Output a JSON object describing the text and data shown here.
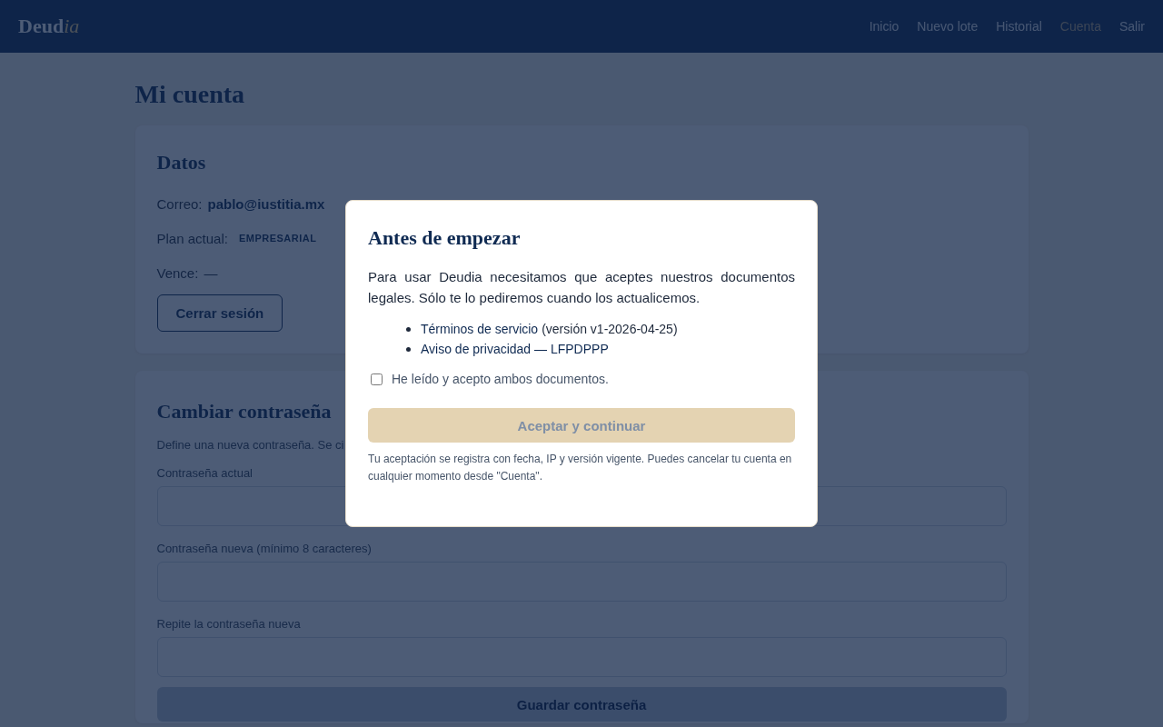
{
  "header": {
    "logo": {
      "main": "Deud",
      "accent": "ia"
    },
    "nav": [
      {
        "label": "Inicio",
        "selected": false
      },
      {
        "label": "Nuevo lote",
        "selected": false
      },
      {
        "label": "Historial",
        "selected": false
      },
      {
        "label": "Cuenta",
        "selected": true
      },
      {
        "label": "Salir",
        "selected": false
      }
    ]
  },
  "page_title": "Mi cuenta",
  "account_card": {
    "title": "Datos",
    "email_label": "Correo:",
    "email": "pablo@iustitia.mx",
    "plan_label": "Plan actual:",
    "plan": "EMPRESARIAL",
    "expires_label": "Vence:",
    "expires": "—",
    "logout_button": "Cerrar sesión"
  },
  "password_card": {
    "title": "Cambiar contraseña",
    "description": "Define una nueva contraseña. Se ci",
    "fields": [
      {
        "label": "Contraseña actual"
      },
      {
        "label": "Contraseña nueva (mínimo 8 caracteres)"
      },
      {
        "label": "Repite la contraseña nueva"
      }
    ],
    "save_button": "Guardar contraseña"
  },
  "modal": {
    "title": "Antes de empezar",
    "body": "Para usar Deudia necesitamos que aceptes nuestros documentos legales. Sólo te lo pediremos cuando los actualicemos.",
    "documents": [
      {
        "link": "Términos de servicio",
        "note": "(versión v1-2026-04-25)"
      },
      {
        "link": "Aviso de privacidad — LFPDPPP"
      }
    ],
    "consent": {
      "label": "He leído y acepto ambos documentos.",
      "checked": false
    },
    "accept_button": {
      "label": "Aceptar y continuar",
      "disabled": true
    },
    "footnote": "Tu aceptación se registra con fecha, IP y versión vigente. Puedes cancelar tu cuenta en cualquier momento desde \"Cuenta\"."
  }
}
